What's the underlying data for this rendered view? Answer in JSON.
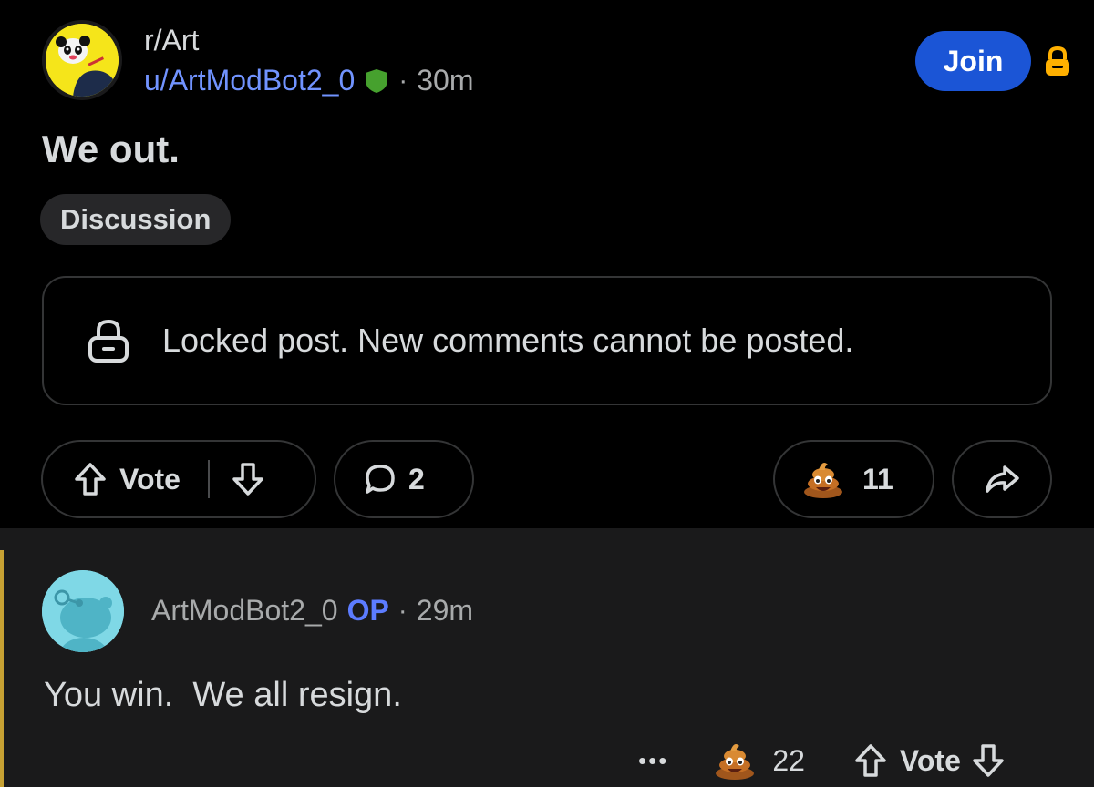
{
  "post": {
    "subreddit": "r/Art",
    "author": "u/ArtModBot2_0",
    "separator": "·",
    "time": "30m",
    "join_label": "Join",
    "title": "We out.",
    "flair": "Discussion",
    "locked_message": "Locked post. New comments cannot be posted.",
    "vote_label": "Vote",
    "comment_count": "2",
    "award_count": "11"
  },
  "comment": {
    "author": "ArtModBot2_0",
    "op_badge": "OP",
    "separator": "·",
    "time": "29m",
    "body": "You win.  We all resign.",
    "more_label": "•••",
    "award_count": "22",
    "vote_label": "Vote"
  },
  "colors": {
    "background": "#000000",
    "comment_background": "#1a1a1b",
    "link_blue": "#7193ff",
    "join_blue": "#1b55d6",
    "mod_shield_green": "#46a12e",
    "lock_orange": "#ffb000",
    "thread_bar_gold": "#c6a133"
  },
  "icons": [
    "panda-avatar",
    "shield-icon",
    "lock-icon",
    "upvote-icon",
    "downvote-icon",
    "comment-icon",
    "poop-award-icon",
    "share-icon",
    "snoo-avatar"
  ]
}
